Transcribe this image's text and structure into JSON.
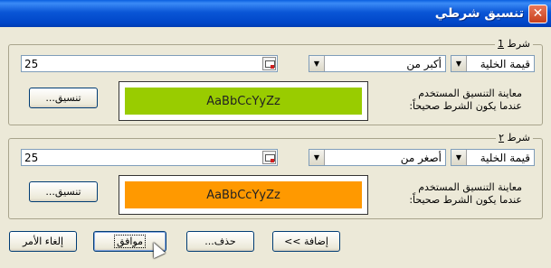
{
  "window": {
    "title": "تنسيق شرطي",
    "close_symbol": "✕"
  },
  "conditions": [
    {
      "label": "شرط ",
      "label_num": "1",
      "type_value": "قيمة الخلية",
      "operator_value": "أكبر من",
      "value": "25",
      "description_line1": "معاينة التنسيق المستخدم",
      "description_line2": "عندما يكون الشرط صحيحاً:",
      "preview_text": "AaBbCcYyZz",
      "preview_color": "#99cc00",
      "format_button": "تنسيق..."
    },
    {
      "label": "شرط ",
      "label_num": "٢",
      "type_value": "قيمة الخلية",
      "operator_value": "أصغر من",
      "value": "25",
      "description_line1": "معاينة التنسيق المستخدم",
      "description_line2": "عندما يكون الشرط صحيحاً:",
      "preview_text": "AaBbCcYyZz",
      "preview_color": "#ff9900",
      "format_button": "تنسيق..."
    }
  ],
  "buttons": {
    "add": "إضافة >>",
    "delete": "حذف...",
    "ok": "موافق",
    "cancel": "إلغاء الأمر"
  },
  "icons": {
    "dropdown_arrow": "▼",
    "collapse_dialog": "collapse-dialog-icon",
    "mouse_cursor": "arrow-cursor-icon"
  }
}
